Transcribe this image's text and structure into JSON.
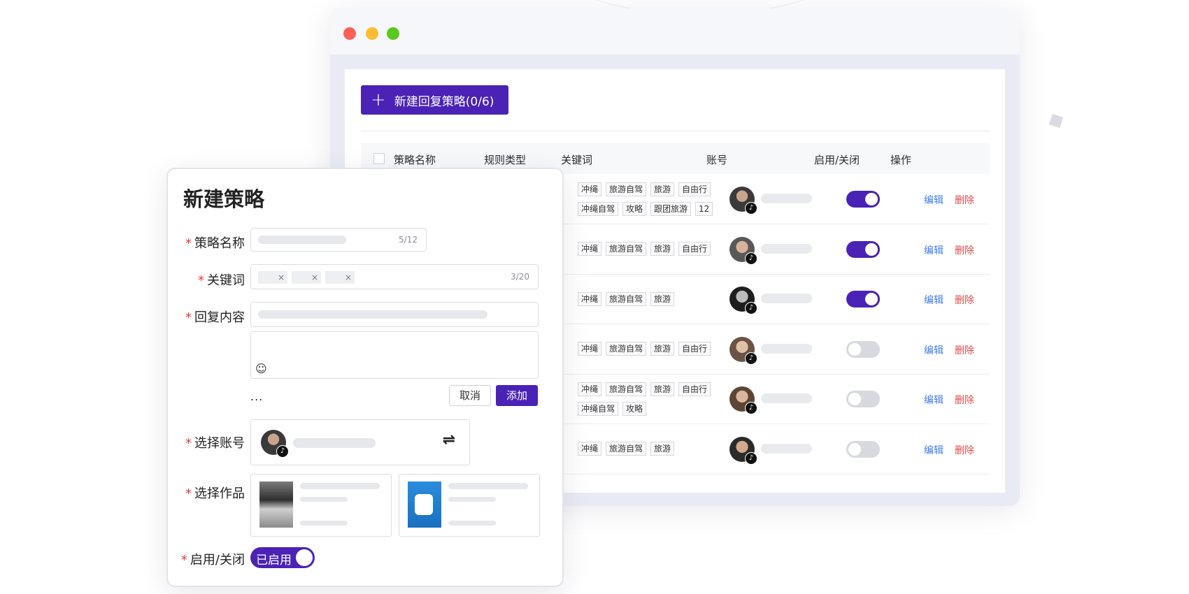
{
  "window": {
    "new_button_label": "新建回复策略(0/6)",
    "columns": [
      "策略名称",
      "规则类型",
      "关键词",
      "账号",
      "启用/关闭",
      "操作"
    ],
    "rows": [
      {
        "tags": [
          [
            "冲绳",
            "旅游自驾",
            "旅游",
            "自由行"
          ],
          [
            "冲绳自驾",
            "攻略",
            "跟团旅游",
            "12"
          ]
        ],
        "enabled": true,
        "edit": "编辑",
        "delete": "删除"
      },
      {
        "tags": [
          [
            "冲绳",
            "旅游自驾",
            "旅游",
            "自由行"
          ]
        ],
        "enabled": true,
        "edit": "编辑",
        "delete": "删除"
      },
      {
        "tags": [
          [
            "冲绳",
            "旅游自驾",
            "旅游"
          ]
        ],
        "enabled": true,
        "edit": "编辑",
        "delete": "删除"
      },
      {
        "tags": [
          [
            "冲绳",
            "旅游自驾",
            "旅游",
            "自由行"
          ]
        ],
        "enabled": false,
        "edit": "编辑",
        "delete": "删除"
      },
      {
        "tags": [
          [
            "冲绳",
            "旅游自驾",
            "旅游",
            "自由行"
          ],
          [
            "冲绳自驾",
            "攻略"
          ]
        ],
        "enabled": false,
        "edit": "编辑",
        "delete": "删除"
      },
      {
        "tags": [
          [
            "冲绳",
            "旅游自驾",
            "旅游"
          ]
        ],
        "enabled": false,
        "edit": "编辑",
        "delete": "删除"
      }
    ]
  },
  "modal": {
    "title": "新建策略",
    "required_mark": "*",
    "labels": {
      "name": "策略名称",
      "keywords": "关键词",
      "reply": "回复内容",
      "account": "选择账号",
      "works": "选择作品",
      "toggle": "启用/关闭"
    },
    "name_counter": "5/12",
    "keyword_counter": "3/20",
    "chip_close": "×",
    "cancel_label": "取消",
    "add_label": "添加",
    "ellipsis": "...",
    "toggle_label": "已启用",
    "toggle_enabled": true
  },
  "icons": {
    "plus": "plus-icon",
    "emoji": "emoji-icon",
    "swap": "swap-icon",
    "tiktok": "tiktok-icon"
  },
  "colors": {
    "accent": "#4a22b6",
    "edit": "#3f7de8",
    "delete": "#e24a4a",
    "required": "#e23b3b",
    "toggle_off": "#d7d9de"
  }
}
